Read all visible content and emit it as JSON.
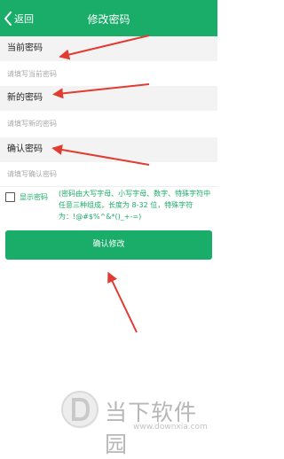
{
  "header": {
    "back_label": "返回",
    "title": "修改密码",
    "bg_color": "#1aad6a"
  },
  "current": {
    "label": "当前密码",
    "placeholder": "请填写当前密码"
  },
  "new": {
    "label": "新的密码",
    "placeholder": "请填写新的密码"
  },
  "confirm": {
    "label": "确认密码",
    "placeholder": "请填写确认密码"
  },
  "show_password": {
    "label": "显示密码",
    "checked": false
  },
  "hint": "(密码由大写字母、小写字母、数字、特殊字符中任意三种组成，长度为 8-32 位，特殊字符为：!@#$%^&*()_+-=)",
  "submit": {
    "label": "确认修改"
  },
  "annotation": {
    "color": "#e03c31",
    "icon": "red-arrow"
  },
  "watermark": {
    "text": "当下软件园",
    "url": "www.downxia.com",
    "icon": "d-logo-icon"
  }
}
